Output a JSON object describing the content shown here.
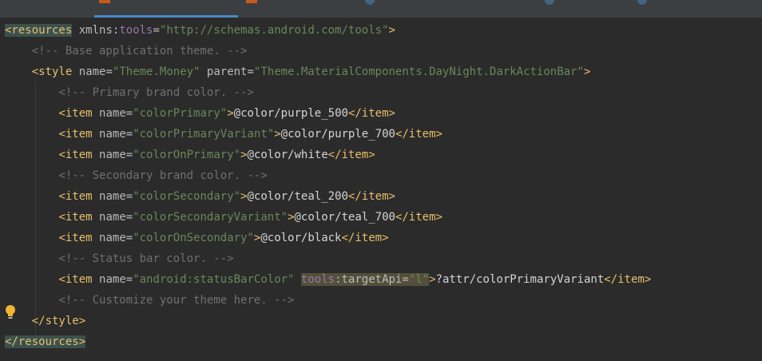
{
  "colors": {
    "background": "#2b2b2b",
    "tag": "#e8bf6a",
    "attribute": "#bababa",
    "namespace": "#9876aa",
    "value": "#6a8759",
    "comment": "#707070",
    "text": "#d4d4d4"
  },
  "code": {
    "l1": {
      "tag_open": "<resources",
      "attr": "xmlns:",
      "ns": "tools",
      "eq": "=",
      "val": "\"http://schemas.android.com/tools\"",
      "tag_close": ">"
    },
    "l2": {
      "comment": "<!-- Base application theme. -->"
    },
    "l3": {
      "tag_open": "<style",
      "a1": "name",
      "eq1": "=",
      "v1": "\"Theme.Money\"",
      "a2": "parent",
      "eq2": "=",
      "v2": "\"Theme.MaterialComponents.DayNight.DarkActionBar\"",
      "tag_close": ">"
    },
    "l4": {
      "comment": "<!-- Primary brand color. -->"
    },
    "l5": {
      "tag_open": "<item",
      "attr": "name",
      "eq": "=",
      "val": "\"colorPrimary\"",
      "gt": ">",
      "text": "@color/purple_500",
      "tag_end": "</item>"
    },
    "l6": {
      "tag_open": "<item",
      "attr": "name",
      "eq": "=",
      "val": "\"colorPrimaryVariant\"",
      "gt": ">",
      "text": "@color/purple_700",
      "tag_end": "</item>"
    },
    "l7": {
      "tag_open": "<item",
      "attr": "name",
      "eq": "=",
      "val": "\"colorOnPrimary\"",
      "gt": ">",
      "text": "@color/white",
      "tag_end": "</item>"
    },
    "l8": {
      "comment": "<!-- Secondary brand color. -->"
    },
    "l9": {
      "tag_open": "<item",
      "attr": "name",
      "eq": "=",
      "val": "\"colorSecondary\"",
      "gt": ">",
      "text": "@color/teal_200",
      "tag_end": "</item>"
    },
    "l10": {
      "tag_open": "<item",
      "attr": "name",
      "eq": "=",
      "val": "\"colorSecondaryVariant\"",
      "gt": ">",
      "text": "@color/teal_700",
      "tag_end": "</item>"
    },
    "l11": {
      "tag_open": "<item",
      "attr": "name",
      "eq": "=",
      "val": "\"colorOnSecondary\"",
      "gt": ">",
      "text": "@color/black",
      "tag_end": "</item>"
    },
    "l12": {
      "comment": "<!-- Status bar color. -->"
    },
    "l13": {
      "tag_open": "<item",
      "attr": "name",
      "eq": "=",
      "val": "\"android:statusBarColor\"",
      "ns": "tools",
      "a2": ":targetApi",
      "eq2": "=",
      "v2": "\"l\"",
      "gt": ">",
      "text": "?attr/colorPrimaryVariant",
      "tag_end": "</item>"
    },
    "l14": {
      "comment": "<!-- Customize your theme here. -->"
    },
    "l15": {
      "tag_end": "</style>"
    },
    "l16": {
      "tag_end": "</resources>"
    }
  },
  "icons": {
    "gutter": "lightbulb-icon"
  }
}
